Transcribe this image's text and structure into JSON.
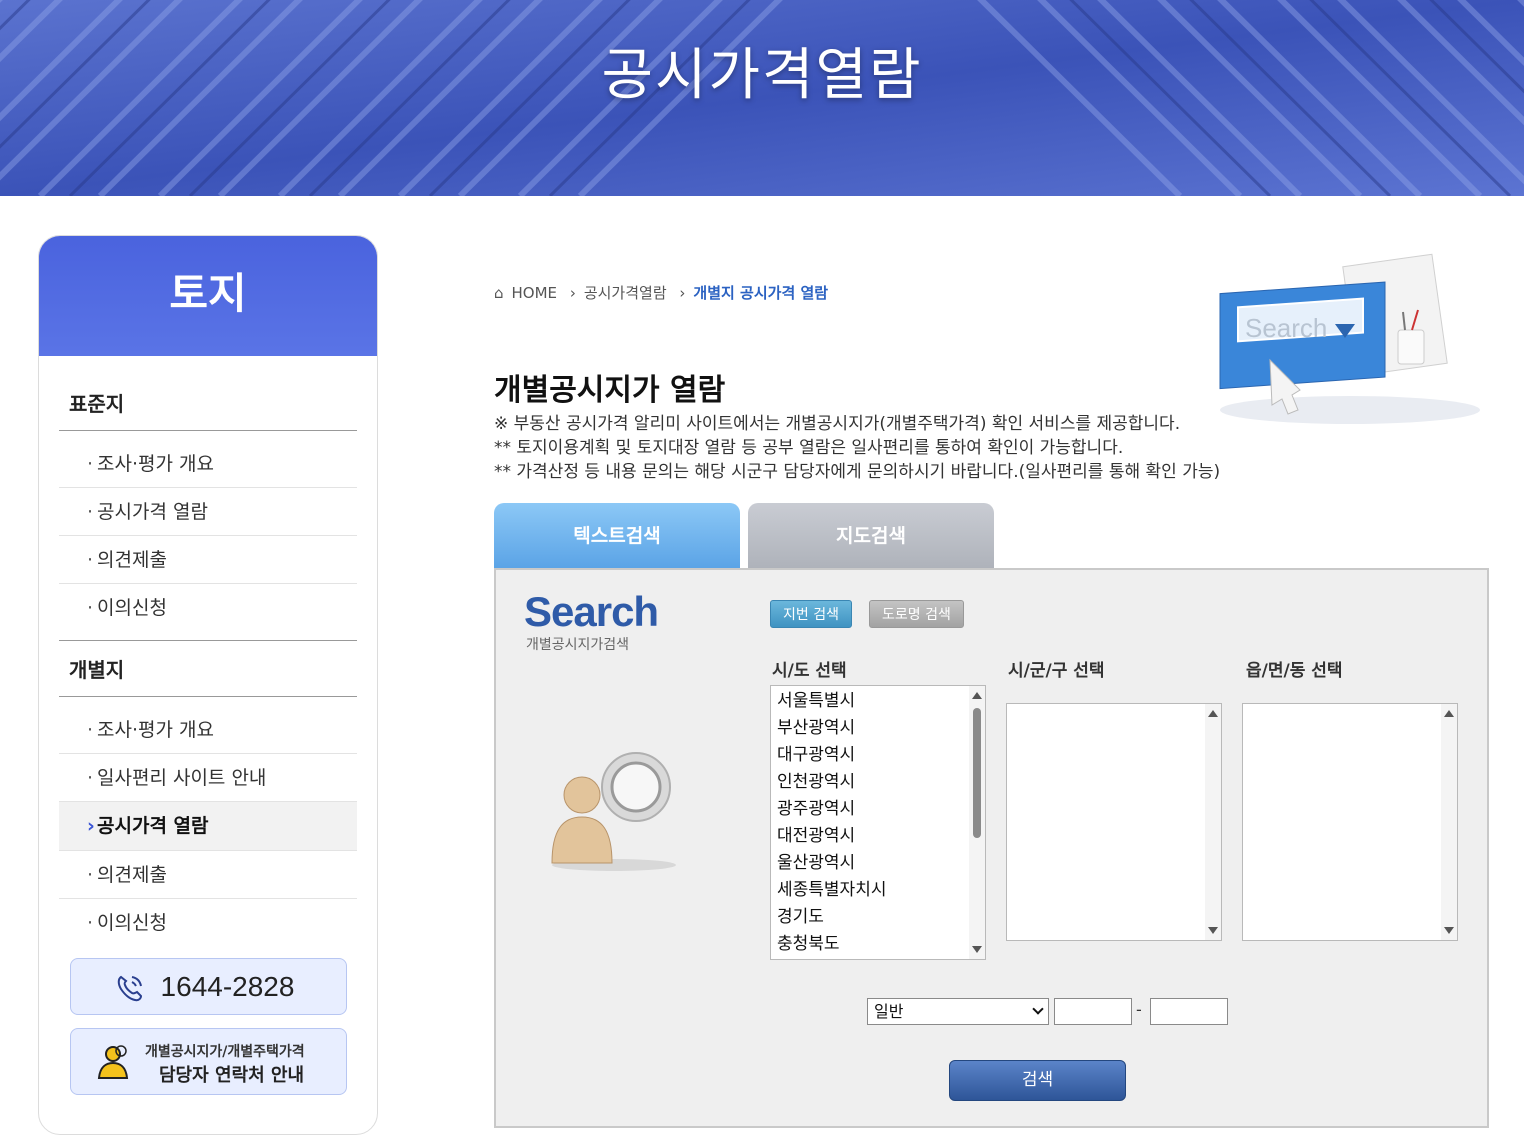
{
  "banner": {
    "title": "공시가격열람"
  },
  "sidebar": {
    "header": "토지",
    "group1": {
      "title": "표준지",
      "items": [
        "조사·평가 개요",
        "공시가격 열람",
        "의견제출",
        "이의신청"
      ]
    },
    "group2": {
      "title": "개별지",
      "items": [
        "조사·평가 개요",
        "일사편리 사이트 안내",
        "공시가격 열람",
        "의견제출",
        "이의신청"
      ],
      "active_index": 2
    },
    "phone": "1644-2828",
    "contact": {
      "line1": "개별공시지가/개별주택가격",
      "line2": "담당자 연락처 안내"
    }
  },
  "breadcrumb": {
    "home": "HOME",
    "level1": "공시가격열람",
    "current": "개별지 공시가격 열람"
  },
  "main": {
    "title": "개별공시지가 열람",
    "notes": [
      "※ 부동산 공시가격 알리미 사이트에서는 개별공시지가(개별주택가격) 확인 서비스를 제공합니다.",
      "** 토지이용계획 및 토지대장 열람 등 공부 열람은 일사편리를 통하여 확인이 가능합니다.",
      "** 가격산정 등 내용 문의는 해당 시군구 담당자에게 문의하시기 바랍니다.(일사편리를 통해 확인 가능)"
    ],
    "tabs": {
      "text_search": "텍스트검색",
      "map_search": "지도검색"
    }
  },
  "panel": {
    "logo": "Search",
    "logo_sub": "개별공시지가검색",
    "illustration_text": "Search",
    "btn_jibun": "지번 검색",
    "btn_road": "도로명 검색",
    "labels": {
      "sido": "시/도 선택",
      "sigungu": "시/군/구 선택",
      "eupmyeondong": "읍/면/동 선택"
    },
    "sido_options": [
      "서울특별시",
      "부산광역시",
      "대구광역시",
      "인천광역시",
      "광주광역시",
      "대전광역시",
      "울산광역시",
      "세종특별자치시",
      "경기도",
      "충청북도"
    ],
    "land_type_selected": "일반",
    "search_button": "검색"
  },
  "colors": {
    "brand_blue": "#4a63de",
    "accent": "#2b62c2"
  }
}
